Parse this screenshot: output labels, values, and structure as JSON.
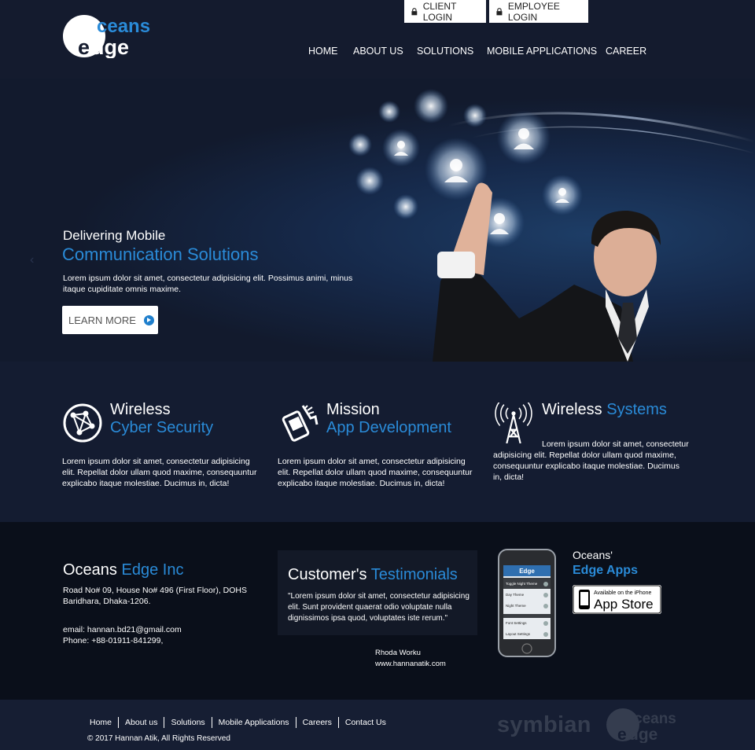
{
  "header": {
    "logo_text": "Oceans Edge",
    "client_login": "CLIENT LOGIN",
    "employee_login": "EMPLOYEE LOGIN",
    "nav": [
      "HOME",
      "ABOUT US",
      "SOLUTIONS",
      "MOBILE APPLICATIONS",
      "CAREER"
    ]
  },
  "hero": {
    "subtitle": "Delivering Mobile",
    "title": "Communication Solutions",
    "text": "Lorem ipsum dolor sit amet, consectetur adipisicing elit. Possimus animi, minus itaque cupiditate omnis maxime.",
    "button": "LEARN MORE",
    "left_arrow": "‹"
  },
  "features": [
    {
      "title1": "Wireless",
      "title2": "Cyber Security",
      "icon": "globe-network-icon",
      "text": "Lorem ipsum dolor sit amet, consectetur adipisicing elit. Repellat dolor ullam quod maxime, consequuntur explicabo itaque molestiae. Ducimus in, dicta!"
    },
    {
      "title1": "Mission",
      "title2": "App Development",
      "icon": "touch-phone-icon",
      "text": "Lorem ipsum dolor sit amet, consectetur adipisicing elit. Repellat dolor ullam quod maxime, consequuntur explicabo itaque molestiae. Ducimus in, dicta!"
    },
    {
      "title1": "Wireless",
      "title2": "Systems",
      "icon": "antenna-tower-icon",
      "text": "Lorem ipsum dolor sit amet, consectetur adipisicing elit. Repellat dolor ullam quod maxime, consequuntur explicabo itaque molestiae. Ducimus in, dicta!"
    }
  ],
  "company": {
    "name1": "Oceans",
    "name2": "Edge Inc",
    "address": "Road No# 09, House No# 496 (First Floor), DOHS Baridhara, Dhaka-1206.",
    "email": "email: hannan.bd21@gmail.com",
    "phone": "Phone: +88-01911-841299,"
  },
  "testimonials": {
    "title1": "Customer's",
    "title2": "Testimonials",
    "quote": "\"Lorem ipsum dolor sit amet, consectetur adipisicing elit. Sunt provident quaerat odio voluptate nulla dignissimos ipsa quod, voluptates iste rerum.\"",
    "name": "Rhoda Worku",
    "site": "www.hannanatik.com"
  },
  "apps": {
    "line1": "Oceans'",
    "line2": "Edge Apps",
    "store_small": "Available on the iPhone",
    "store_big": "App Store",
    "phone_rows": [
      "Toggle Night Theme",
      "Day Theme",
      "Night Theme",
      "Font Settings",
      "Layout Settings"
    ]
  },
  "footer": {
    "nav": [
      "Home",
      "About us",
      "Solutions",
      "Mobile Applications",
      "Careers",
      "Contact Us"
    ],
    "copyright": "© 2017 Hannan Atik, All Rights Reserved",
    "partner": "symbian"
  },
  "colors": {
    "accent": "#2a8bd8",
    "background": "#121a2d",
    "dark_band": "#0a0f1a"
  }
}
